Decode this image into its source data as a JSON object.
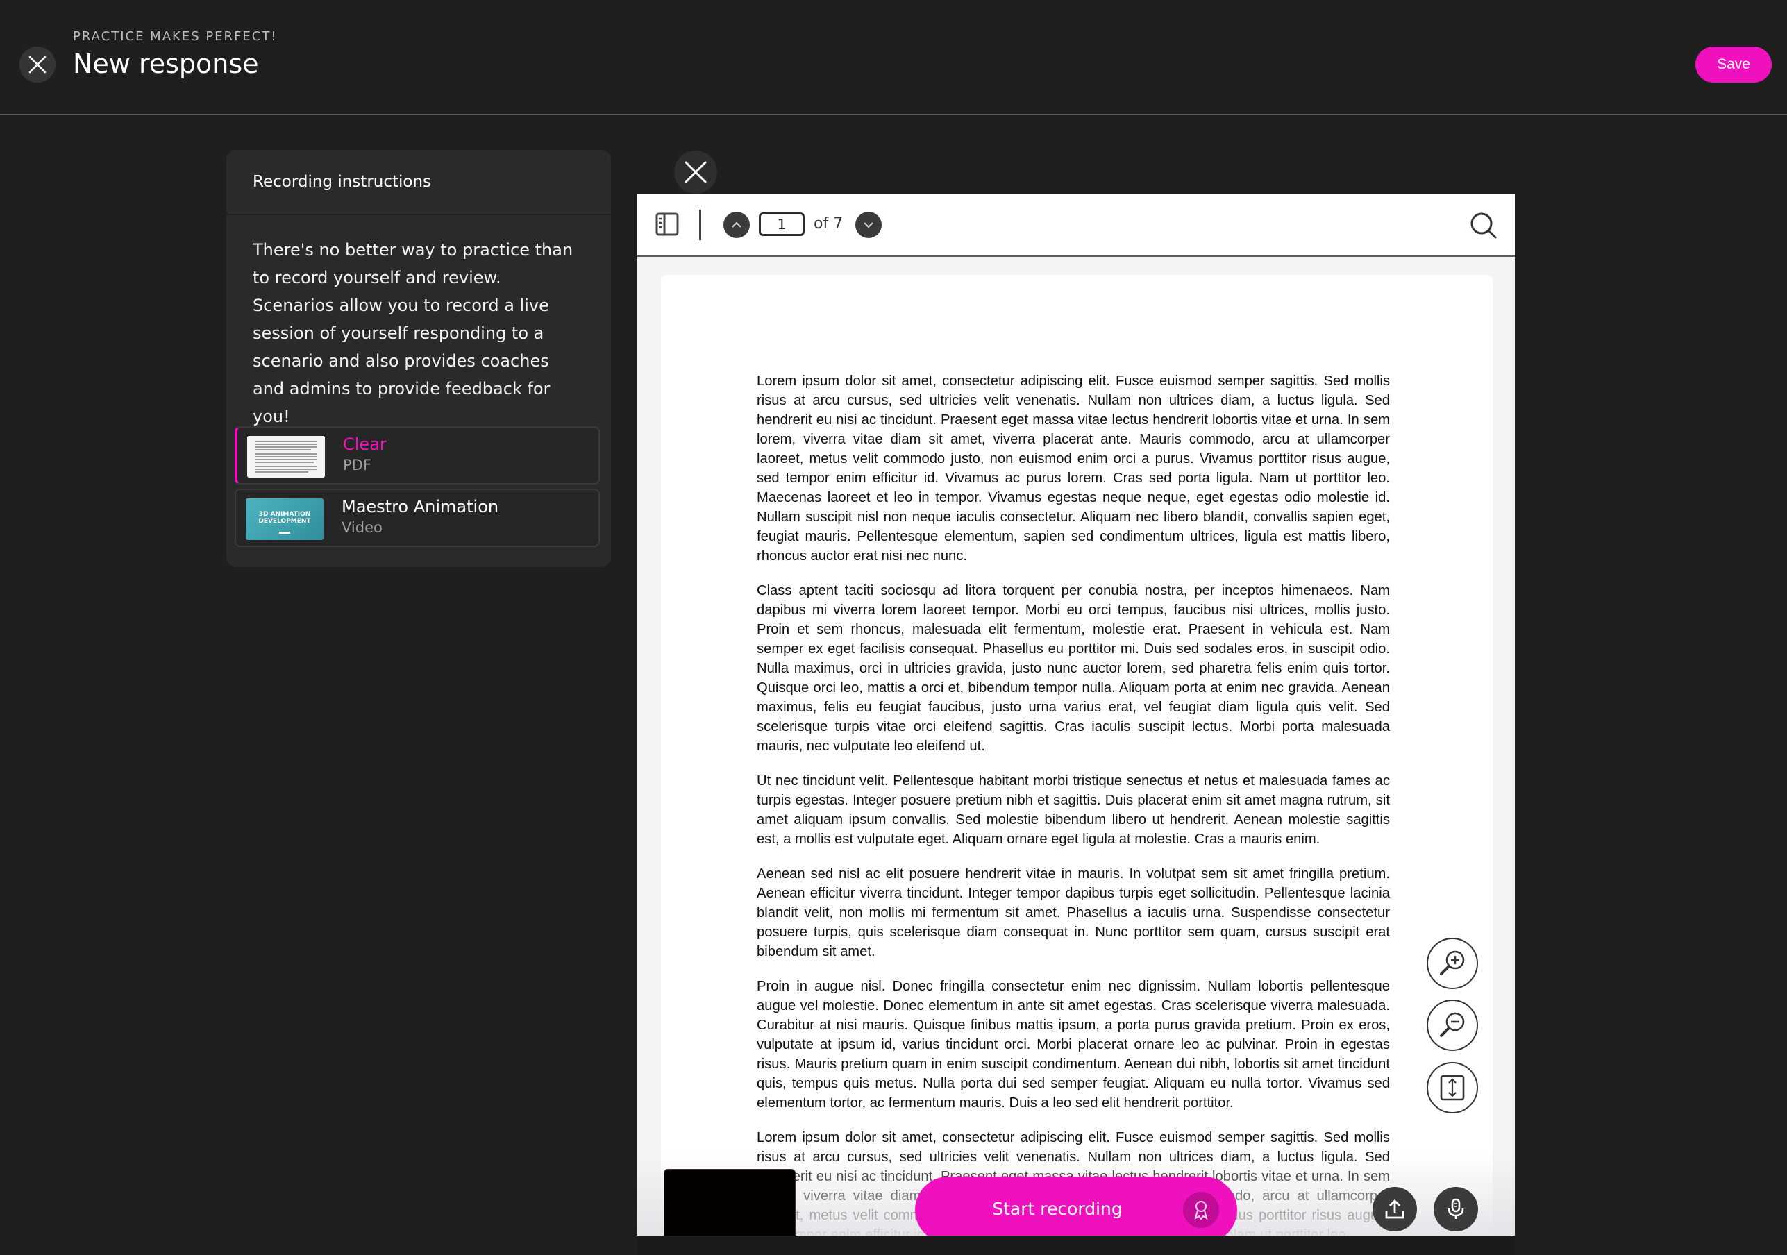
{
  "header": {
    "subtitle": "PRACTICE MAKES PERFECT!",
    "title": "New response",
    "save_label": "Save"
  },
  "instructions": {
    "heading": "Recording instructions",
    "body": "There's no better way to practice than to record yourself and review. Scenarios allow you to record a live session of yourself responding to a scenario and also provides coaches and admins to provide feedback for you!",
    "resources": [
      {
        "name": "Clear",
        "type": "PDF",
        "selected": true
      },
      {
        "name": "Maestro Animation",
        "type": "Video",
        "selected": false,
        "thumb_text": "3D ANIMATION DEVELOPMENT"
      }
    ]
  },
  "viewer": {
    "current_page": "1",
    "of_total": "of 7",
    "paragraphs": [
      "Lorem ipsum dolor sit amet, consectetur adipiscing elit. Fusce euismod semper sagittis. Sed mollis risus at arcu cursus, sed ultricies velit venenatis. Nullam non ultrices diam, a luctus ligula. Sed hendrerit eu nisi ac tincidunt. Praesent eget massa vitae lectus hendrerit lobortis vitae et urna. In sem lorem, viverra vitae diam sit amet, viverra placerat ante. Mauris commodo, arcu at ullamcorper laoreet, metus velit commodo justo, non euismod enim orci a purus. Vivamus porttitor risus augue, sed tempor enim efficitur id. Vivamus ac purus lorem. Cras sed porta ligula. Nam ut porttitor leo. Maecenas laoreet et leo in tempor. Vivamus egestas neque neque, eget egestas odio molestie id. Nullam suscipit nisl non neque iaculis consectetur. Aliquam nec libero blandit, convallis sapien eget, feugiat mauris. Pellentesque elementum, sapien sed condimentum ultrices, ligula est mattis libero, rhoncus auctor erat nisi nec nunc.",
      "Class aptent taciti sociosqu ad litora torquent per conubia nostra, per inceptos himenaeos. Nam dapibus mi viverra lorem laoreet tempor. Morbi eu orci tempus, faucibus nisi ultrices, mollis justo. Proin et sem rhoncus, malesuada elit fermentum, molestie erat. Praesent in vehicula est. Nam semper ex eget facilisis consequat. Phasellus eu porttitor mi. Duis sed sodales eros, in suscipit odio. Nulla maximus, orci in ultricies gravida, justo nunc auctor lorem, sed pharetra felis enim quis tortor. Quisque orci leo, mattis a orci et, bibendum tempor nulla. Aliquam porta at enim nec gravida. Aenean maximus, felis eu feugiat faucibus, justo urna varius erat, vel feugiat diam ligula quis velit. Sed scelerisque turpis vitae orci eleifend sagittis. Cras iaculis suscipit lectus. Morbi porta malesuada mauris, nec vulputate leo eleifend ut.",
      "Ut nec tincidunt velit. Pellentesque habitant morbi tristique senectus et netus et malesuada fames ac turpis egestas. Integer posuere pretium nibh et sagittis. Duis placerat enim sit amet magna rutrum, sit amet aliquam ipsum convallis. Sed molestie bibendum libero ut hendrerit. Aenean molestie sagittis est, a mollis est vulputate eget. Aliquam ornare eget ligula at molestie. Cras a mauris enim.",
      "Aenean sed nisl ac elit posuere hendrerit vitae in mauris. In volutpat sem sit amet fringilla pretium. Aenean efficitur viverra tincidunt. Integer tempor dapibus turpis eget sollicitudin. Pellentesque lacinia blandit velit, non mollis mi fermentum sit amet. Phasellus a iaculis urna. Suspendisse consectetur posuere turpis, quis scelerisque diam consequat in. Nunc porttitor sem quam, cursus suscipit erat bibendum sit amet.",
      "Proin in augue nisl. Donec fringilla consectetur enim nec dignissim. Nullam lobortis pellentesque augue vel molestie. Donec elementum in ante sit amet egestas. Cras scelerisque viverra malesuada. Curabitur at nisi mauris. Quisque finibus mattis ipsum, a porta purus gravida pretium. Proin ex eros, vulputate at ipsum id, varius tincidunt orci. Morbi placerat ornare leo ac pulvinar. Proin in egestas risus. Mauris pretium quam in enim suscipit condimentum. Aenean dui nibh, lobortis sit amet tincidunt quis, tempus quis metus. Nulla porta dui sed semper feugiat. Aliquam eu nulla tortor. Vivamus sed elementum tortor, ac fermentum mauris. Duis a leo sed elit hendrerit porttitor.",
      "Lorem ipsum dolor sit amet, consectetur adipiscing elit. Fusce euismod semper sagittis. Sed mollis risus at arcu cursus, sed ultricies velit venenatis. Nullam non ultrices diam, a luctus ligula. Sed hendrerit eu nisi ac tincidunt. Praesent eget massa vitae lectus hendrerit lobortis vitae et urna. In sem lorem, viverra vitae diam sit amet, viverra placerat ante. Mauris commodo, arcu at ullamcorper laoreet, metus velit commodo justo, non euismod enim orci a purus. Vivamus porttitor risus augue, sed tempor enim efficitur id. Vivamus ac purus lorem. Cras sed porta ligula. Nam ut porttitor leo."
    ]
  },
  "recording": {
    "start_label": "Start recording"
  },
  "icons": {
    "close": "close-icon",
    "sidebar_toggle": "sidebar-toggle-icon",
    "page_up": "chevron-up-icon",
    "page_down": "chevron-down-icon",
    "search": "search-icon",
    "zoom_in": "zoom-in-icon",
    "zoom_out": "zoom-out-icon",
    "fit_page": "fit-page-icon",
    "upload": "upload-icon",
    "microphone": "microphone-icon",
    "badge": "ribbon-badge-icon"
  },
  "colors": {
    "accent": "#ee11bd",
    "background": "#1f1f1f",
    "panel": "#2a2a2b"
  }
}
